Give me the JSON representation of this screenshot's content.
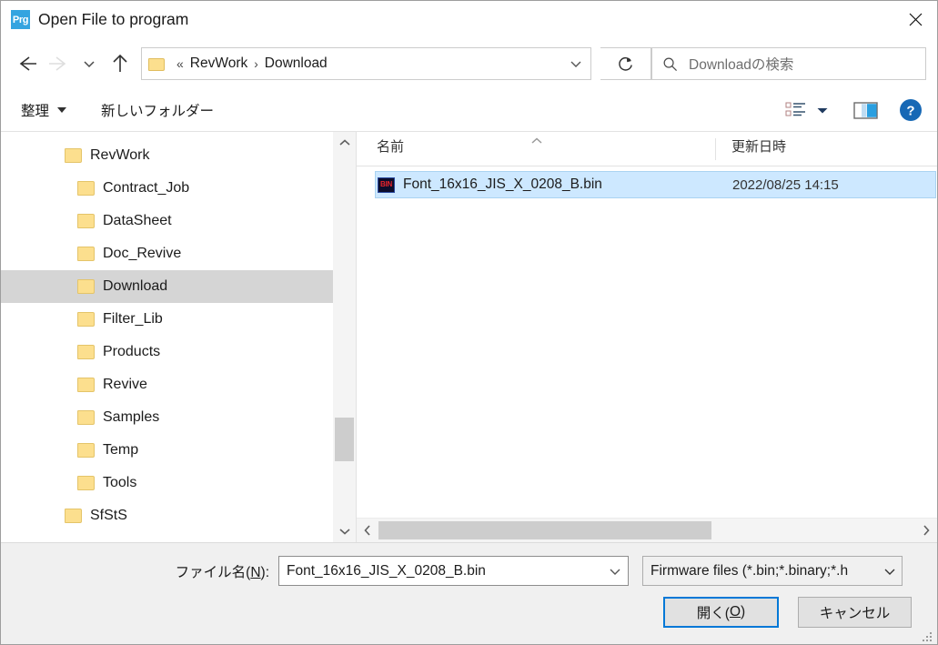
{
  "window": {
    "title": "Open File to program",
    "app_icon_label": "Prg",
    "close_label": "×"
  },
  "nav": {
    "back_icon": "back-arrow-icon",
    "forward_icon": "forward-arrow-icon",
    "recent_icon": "chevron-down-icon",
    "up_icon": "up-arrow-icon",
    "breadcrumb": {
      "overflow": "«",
      "separator": "›",
      "items": [
        "RevWork",
        "Download"
      ]
    },
    "address_dropdown_icon": "chevron-down-icon",
    "refresh_icon": "refresh-icon"
  },
  "search": {
    "placeholder": "Downloadの検索",
    "icon": "search-icon"
  },
  "toolbar": {
    "organize_label": "整理",
    "new_folder_label": "新しいフォルダー",
    "view_icon": "view-options-icon",
    "view_caret_icon": "chevron-down-icon",
    "preview_pane_icon": "preview-pane-icon",
    "help_icon": "help-icon",
    "help_label": "?"
  },
  "tree": {
    "items": [
      {
        "label": "RevWork",
        "level": 0,
        "selected": false
      },
      {
        "label": "Contract_Job",
        "level": 1,
        "selected": false
      },
      {
        "label": "DataSheet",
        "level": 1,
        "selected": false
      },
      {
        "label": "Doc_Revive",
        "level": 1,
        "selected": false
      },
      {
        "label": "Download",
        "level": 1,
        "selected": true
      },
      {
        "label": "Filter_Lib",
        "level": 1,
        "selected": false
      },
      {
        "label": "Products",
        "level": 1,
        "selected": false
      },
      {
        "label": "Revive",
        "level": 1,
        "selected": false
      },
      {
        "label": "Samples",
        "level": 1,
        "selected": false
      },
      {
        "label": "Temp",
        "level": 1,
        "selected": false
      },
      {
        "label": "Tools",
        "level": 1,
        "selected": false
      },
      {
        "label": "SfStS",
        "level": 0,
        "selected": false
      }
    ]
  },
  "file_list": {
    "columns": [
      {
        "key": "name",
        "label": "名前",
        "sorted": "asc"
      },
      {
        "key": "date",
        "label": "更新日時",
        "sorted": ""
      }
    ],
    "rows": [
      {
        "name": "Font_16x16_JIS_X_0208_B.bin",
        "date": "2022/08/25 14:15",
        "icon": "bin-file-icon",
        "icon_label": "BIN",
        "selected": true
      }
    ]
  },
  "footer": {
    "filename_label_pre": "ファイル名(",
    "filename_label_key": "N",
    "filename_label_post": "):",
    "filename_value": "Font_16x16_JIS_X_0208_B.bin",
    "filter_value": "Firmware files (*.bin;*.binary;*.h",
    "open_label_pre": "開く(",
    "open_label_key": "O",
    "open_label_post": ")",
    "cancel_label": "キャンセル"
  },
  "colors": {
    "accent": "#0078d7",
    "selection_blue": "#cde8ff",
    "selection_gray": "#d5d5d5",
    "folder_yellow": "#fcdf8e",
    "app_icon_blue": "#34a4e0"
  }
}
